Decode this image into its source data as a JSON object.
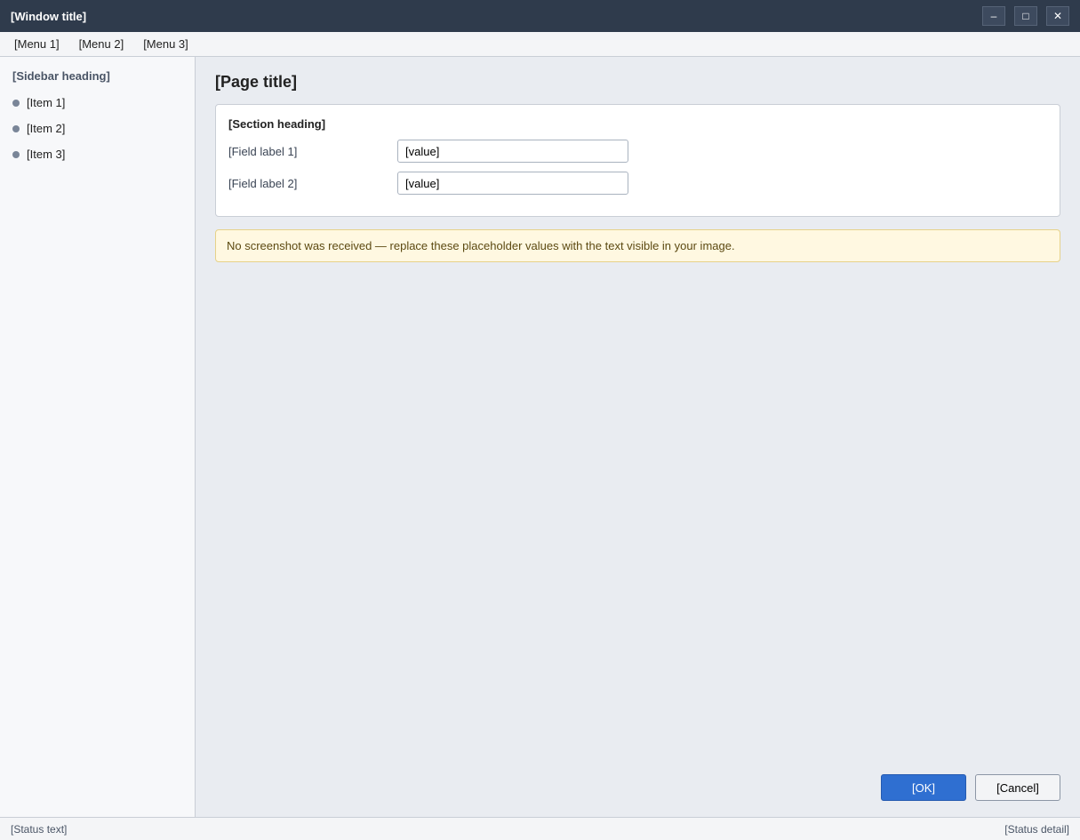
{
  "window": {
    "title": "[Window title]",
    "minimize_glyph": "–",
    "maximize_glyph": "□",
    "close_glyph": "✕"
  },
  "menubar": {
    "items": [
      {
        "label": "[Menu 1]"
      },
      {
        "label": "[Menu 2]"
      },
      {
        "label": "[Menu 3]"
      }
    ]
  },
  "sidebar": {
    "heading": "[Sidebar heading]",
    "items": [
      {
        "label": "[Item 1]"
      },
      {
        "label": "[Item 2]"
      },
      {
        "label": "[Item 3]"
      }
    ]
  },
  "main": {
    "page_title": "[Page title]",
    "panel": {
      "heading": "[Section heading]",
      "fields": [
        {
          "label": "[Field label 1]",
          "value": "[value]",
          "placeholder": ""
        },
        {
          "label": "[Field label 2]",
          "value": "[value]",
          "placeholder": ""
        }
      ]
    },
    "notice": "No screenshot was received — replace these placeholder values with the text visible in your image.",
    "buttons": {
      "primary_label": "[OK]",
      "secondary_label": "[Cancel]"
    }
  },
  "statusbar": {
    "left": "[Status text]",
    "right": "[Status detail]"
  },
  "colors": {
    "titlebar": "#2f3b4c",
    "accent": "#2f6fd1"
  }
}
